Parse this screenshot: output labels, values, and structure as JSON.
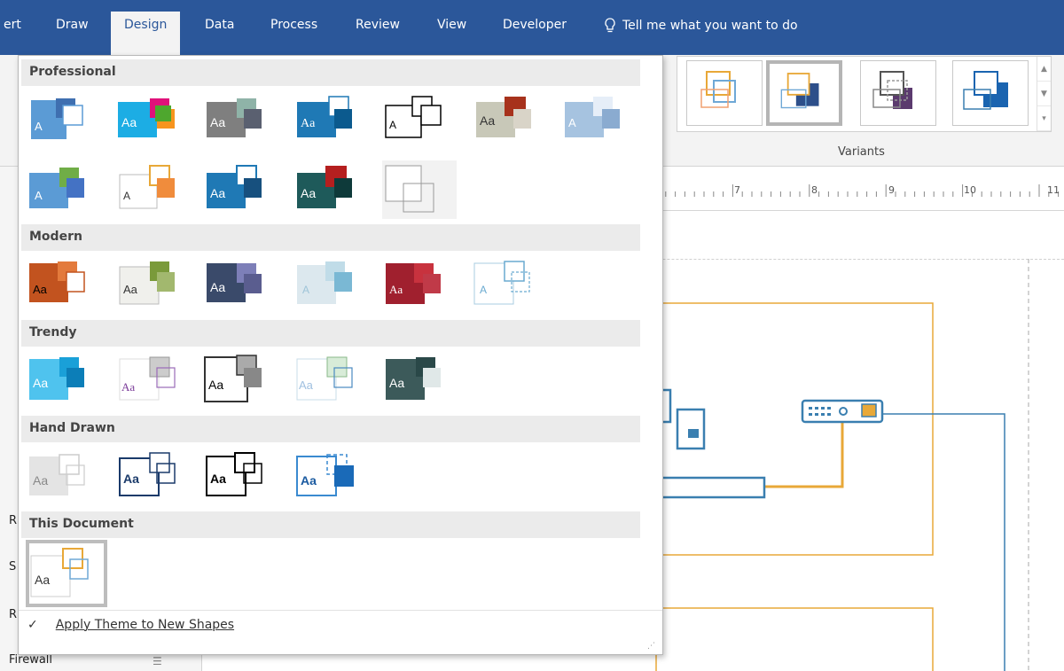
{
  "ribbon": {
    "tabs": [
      "ert",
      "Draw",
      "Design",
      "Data",
      "Process",
      "Review",
      "View",
      "Developer"
    ],
    "active_tab": "Design",
    "tell_me": "Tell me what you want to do",
    "variants_label": "Variants",
    "variants": [
      "variant-1",
      "variant-2",
      "variant-3",
      "variant-4"
    ],
    "selected_variant": 2
  },
  "ruler": {
    "numbers": [
      "7",
      "8",
      "9",
      "10",
      "11"
    ]
  },
  "themes_menu": {
    "sections": [
      {
        "label": "Professional",
        "count": 12
      },
      {
        "label": "Modern",
        "count": 6
      },
      {
        "label": "Trendy",
        "count": 5
      },
      {
        "label": "Hand Drawn",
        "count": 4
      },
      {
        "label": "This Document",
        "count": 1
      }
    ],
    "apply_theme_checked": true,
    "apply_theme_label": "Apply Theme to New Shapes"
  },
  "shapes_pane": {
    "fragments": [
      "R",
      "S",
      "R"
    ],
    "last_item": "Firewall"
  },
  "theme_colors": {
    "ribbon_blue": "#2b579a",
    "line_gold": "#e8a838",
    "line_blue": "#3a7fb0"
  }
}
